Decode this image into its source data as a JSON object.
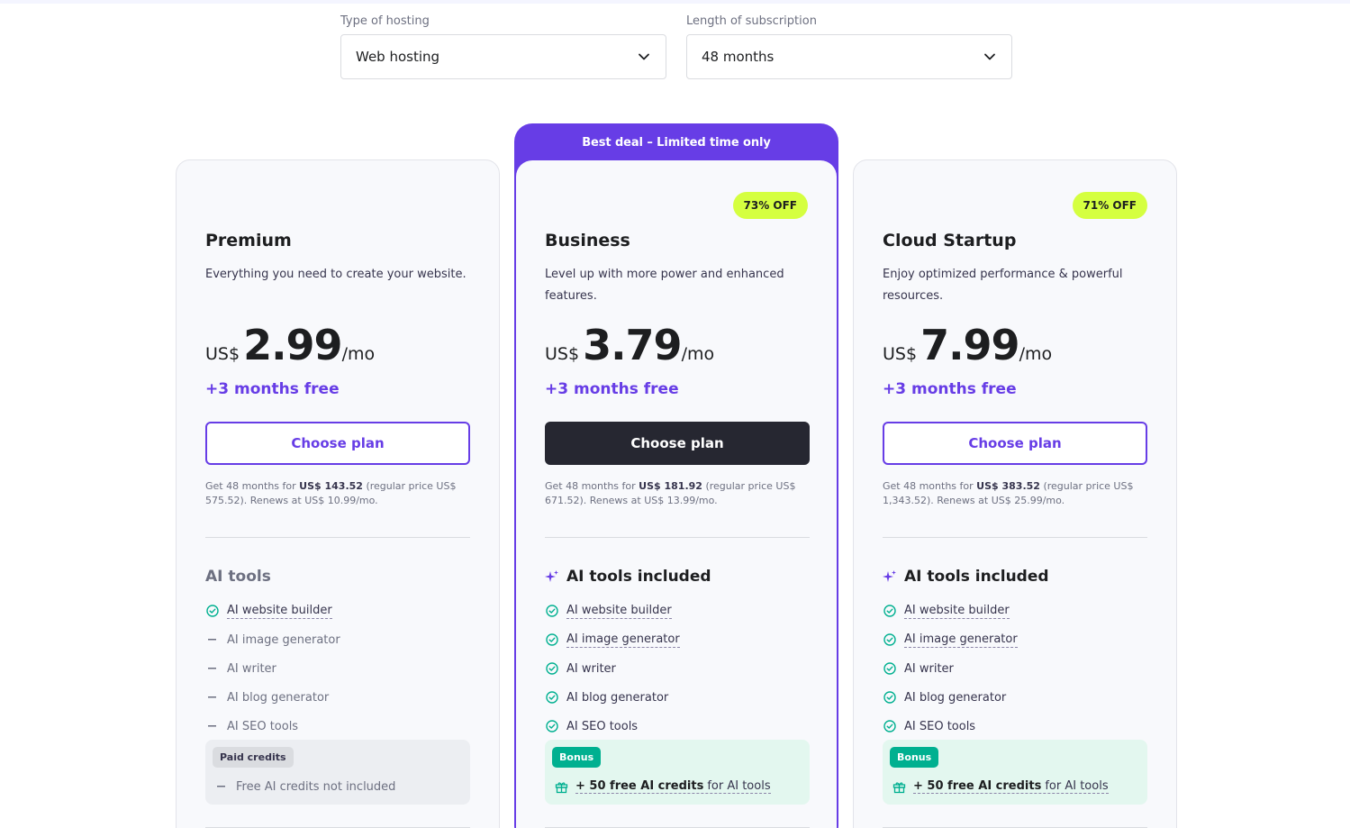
{
  "filters": {
    "hosting": {
      "label": "Type of hosting",
      "value": "Web hosting"
    },
    "subscription": {
      "label": "Length of subscription",
      "value": "48 months"
    }
  },
  "colors": {
    "accent": "#673de6",
    "discount": "#d5ff40",
    "bonus": "#00b090",
    "check": "#00b090",
    "dark_button": "#262731"
  },
  "featured_banner": "Best deal – Limited time only",
  "plans": {
    "premium": {
      "name": "Premium",
      "description": "Everything you need to create your website.",
      "currency": "US$",
      "price": "2.99",
      "period": "/mo",
      "free_months": "+3 months free",
      "cta": "Choose plan",
      "renew_prefix": "Get 48 months for ",
      "renew_total": "US$ 143.52",
      "renew_suffix": " (regular price US$ 575.52). Renews at US$ 10.99/mo.",
      "features_title": "AI tools",
      "features": [
        {
          "label": "AI website builder",
          "included": true
        },
        {
          "label": "AI image generator",
          "included": false
        },
        {
          "label": "AI writer",
          "included": false
        },
        {
          "label": "AI blog generator",
          "included": false
        },
        {
          "label": "AI SEO tools",
          "included": false
        }
      ],
      "credits_tag": "Paid credits",
      "credits_text": "Free AI credits not included"
    },
    "business": {
      "discount": "73% OFF",
      "name": "Business",
      "description": "Level up with more power and enhanced features.",
      "currency": "US$",
      "price": "3.79",
      "period": "/mo",
      "free_months": "+3 months free",
      "cta": "Choose plan",
      "renew_prefix": "Get 48 months for ",
      "renew_total": "US$ 181.92",
      "renew_suffix": " (regular price US$ 671.52). Renews at US$ 13.99/mo.",
      "features_title": "AI tools included",
      "features": [
        {
          "label": "AI website builder",
          "included": true
        },
        {
          "label": "AI image generator",
          "included": true
        },
        {
          "label": "AI writer",
          "included": true
        },
        {
          "label": "AI blog generator",
          "included": true
        },
        {
          "label": "AI SEO tools",
          "included": true
        }
      ],
      "credits_tag": "Bonus",
      "credits_bold": "+ 50 free AI credits",
      "credits_rest": "for AI tools"
    },
    "cloud": {
      "discount": "71% OFF",
      "name": "Cloud Startup",
      "description": "Enjoy optimized performance & powerful resources.",
      "currency": "US$",
      "price": "7.99",
      "period": "/mo",
      "free_months": "+3 months free",
      "cta": "Choose plan",
      "renew_prefix": "Get 48 months for ",
      "renew_total": "US$ 383.52",
      "renew_suffix": " (regular price US$ 1,343.52). Renews at US$ 25.99/mo.",
      "features_title": "AI tools included",
      "features": [
        {
          "label": "AI website builder",
          "included": true
        },
        {
          "label": "AI image generator",
          "included": true
        },
        {
          "label": "AI writer",
          "included": true
        },
        {
          "label": "AI blog generator",
          "included": true
        },
        {
          "label": "AI SEO tools",
          "included": true
        }
      ],
      "credits_tag": "Bonus",
      "credits_bold": "+ 50 free AI credits",
      "credits_rest": "for AI tools"
    }
  }
}
